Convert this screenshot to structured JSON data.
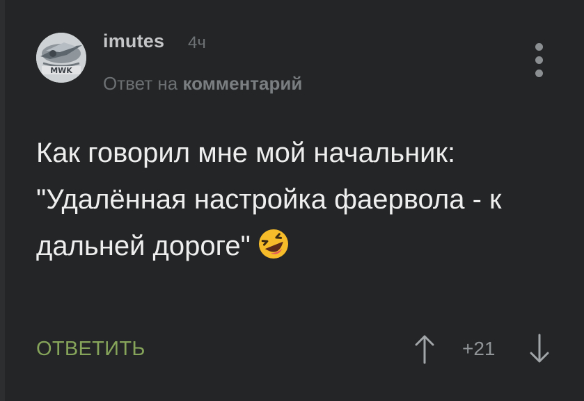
{
  "comment": {
    "author": "imutes",
    "time": "4ч",
    "reply_prefix": "Ответ на",
    "reply_target": "комментарий",
    "text": "Как говорил мне мой начальник: \"Удалённая настройка фаервола - к дальней дороге\"",
    "emoji": "laughing-face-emoji",
    "avatar_label": "MWK"
  },
  "actions": {
    "reply_label": "ОТВЕТИТЬ",
    "rating": "+21",
    "upvote_icon": "arrow-up-icon",
    "downvote_icon": "arrow-down-icon",
    "menu_icon": "more-vertical-icon"
  },
  "colors": {
    "background": "#232526",
    "text": "#eeeeee",
    "accent_green": "#86a55a",
    "muted": "#6d7073"
  }
}
